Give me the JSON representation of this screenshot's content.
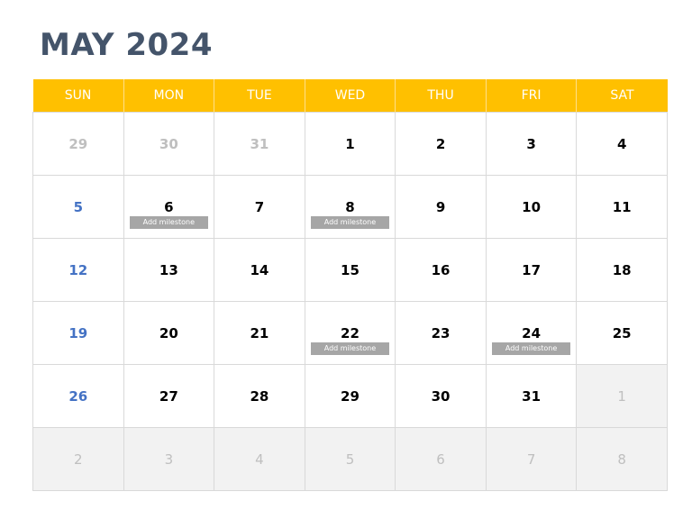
{
  "title": "MAY 2024",
  "weekdays": [
    "SUN",
    "MON",
    "TUE",
    "WED",
    "THU",
    "FRI",
    "SAT"
  ],
  "colors": {
    "header_bg": "#ffc000",
    "title": "#44546a",
    "sunday": "#4472c4",
    "muted_text": "#bfbfbf",
    "milestone_bg": "#a6a6a6",
    "next_month_bg": "#f2f2f2"
  },
  "weeks": [
    [
      {
        "day": "29",
        "type": "prev"
      },
      {
        "day": "30",
        "type": "prev"
      },
      {
        "day": "31",
        "type": "prev"
      },
      {
        "day": "1",
        "type": "current"
      },
      {
        "day": "2",
        "type": "current"
      },
      {
        "day": "3",
        "type": "current"
      },
      {
        "day": "4",
        "type": "current"
      }
    ],
    [
      {
        "day": "5",
        "type": "current"
      },
      {
        "day": "6",
        "type": "current",
        "milestone": "Add milestone"
      },
      {
        "day": "7",
        "type": "current"
      },
      {
        "day": "8",
        "type": "current",
        "milestone": "Add milestone"
      },
      {
        "day": "9",
        "type": "current"
      },
      {
        "day": "10",
        "type": "current"
      },
      {
        "day": "11",
        "type": "current"
      }
    ],
    [
      {
        "day": "12",
        "type": "current"
      },
      {
        "day": "13",
        "type": "current"
      },
      {
        "day": "14",
        "type": "current"
      },
      {
        "day": "15",
        "type": "current"
      },
      {
        "day": "16",
        "type": "current"
      },
      {
        "day": "17",
        "type": "current"
      },
      {
        "day": "18",
        "type": "current"
      }
    ],
    [
      {
        "day": "19",
        "type": "current"
      },
      {
        "day": "20",
        "type": "current"
      },
      {
        "day": "21",
        "type": "current"
      },
      {
        "day": "22",
        "type": "current",
        "milestone": "Add milestone"
      },
      {
        "day": "23",
        "type": "current"
      },
      {
        "day": "24",
        "type": "current",
        "milestone": "Add milestone"
      },
      {
        "day": "25",
        "type": "current"
      }
    ],
    [
      {
        "day": "26",
        "type": "current"
      },
      {
        "day": "27",
        "type": "current"
      },
      {
        "day": "28",
        "type": "current"
      },
      {
        "day": "29",
        "type": "current"
      },
      {
        "day": "30",
        "type": "current"
      },
      {
        "day": "31",
        "type": "current"
      },
      {
        "day": "1",
        "type": "next"
      }
    ],
    [
      {
        "day": "2",
        "type": "next"
      },
      {
        "day": "3",
        "type": "next"
      },
      {
        "day": "4",
        "type": "next"
      },
      {
        "day": "5",
        "type": "next"
      },
      {
        "day": "6",
        "type": "next"
      },
      {
        "day": "7",
        "type": "next"
      },
      {
        "day": "8",
        "type": "next"
      }
    ]
  ]
}
